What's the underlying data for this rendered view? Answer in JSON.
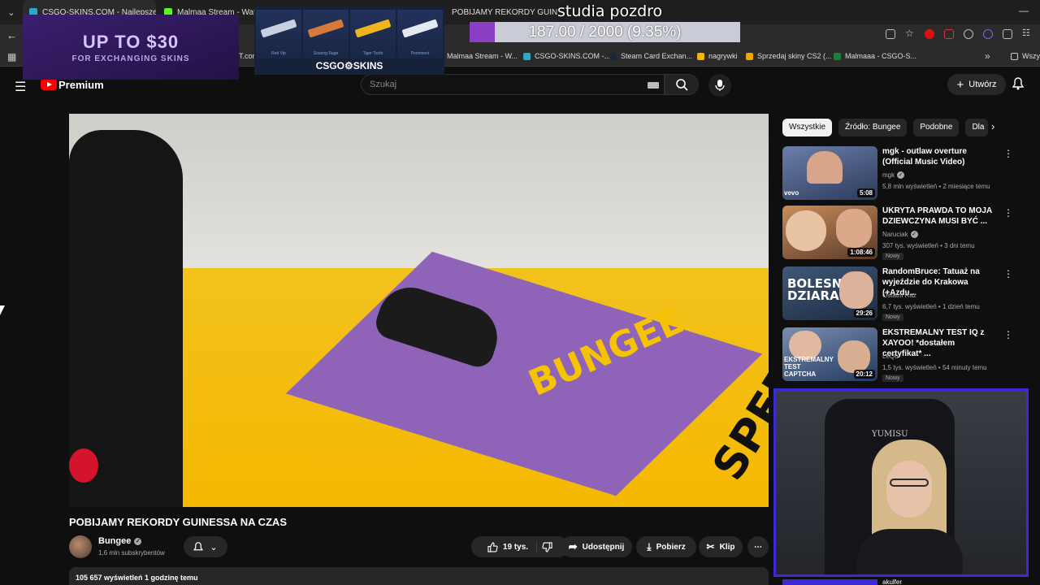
{
  "browser": {
    "tabs": [
      {
        "label": "CSGO-SKINS.COM - Najlepsze",
        "color": "#2aa9c8",
        "active": true
      },
      {
        "label": "Malmaa Stream - Watch Li",
        "color": "#53fc18",
        "active": false
      },
      {
        "label": "POBIJAMY REKORDY GUIN",
        "color": "#ff0000",
        "active": false
      }
    ],
    "bookmarks": [
      {
        "label": "Malmaa Stream - W...",
        "color": "#53fc18"
      },
      {
        "label": "CSGO-SKINS.COM -...",
        "color": "#2aa9c8"
      },
      {
        "label": "Steam Card Exchan...",
        "color": "#1b2838"
      },
      {
        "label": "nagrywki",
        "color": "#f4b400"
      },
      {
        "label": "Sprzedaj skiny CS2 (...",
        "color": "#f0a500"
      },
      {
        "label": "Malmaaa - CSGO-S...",
        "color": "#188038"
      }
    ],
    "bookmark_partial": "T.com",
    "bookmark_folder": "Wszy"
  },
  "overlay": {
    "promo_title": "UP TO $30",
    "promo_sub": "FOR EXCHANGING SKINS",
    "skins_brand": "CSGO⚙SKINS",
    "skins": [
      {
        "name": "Red Vip",
        "color": "#c6d0e0"
      },
      {
        "name": "Soaring Rage",
        "color": "#d47a3a"
      },
      {
        "name": "Tiger Tooth",
        "color": "#f0b51e"
      },
      {
        "name": "Prominent",
        "color": "#e4e8f0"
      }
    ],
    "goal_text": "187.00 / 2000 (9.35%)",
    "goal_fraction": 0.0935,
    "stream_note": "studia pozdro"
  },
  "youtube": {
    "brand": "Premium",
    "search_placeholder": "Szukaj",
    "create_label": "Utwórz"
  },
  "video": {
    "scene_text_mat": "BUNGEE",
    "scene_text_floor": "SPEED",
    "title": "POBIJAMY REKORDY GUINESSA NA CZAS",
    "channel": "Bungee",
    "subscribers": "1,6 mln subskrybentów",
    "likes": "19 tys.",
    "share_label": "Udostępnij",
    "download_label": "Pobierz",
    "clip_label": "Klip",
    "views_line": "105 657 wyświetleń  1 godzinę temu"
  },
  "sidebar": {
    "chips": [
      {
        "label": "Wszystkie",
        "active": true
      },
      {
        "label": "Źródło: Bungee",
        "active": false
      },
      {
        "label": "Podobne",
        "active": false
      },
      {
        "label": "Dla",
        "active": false
      }
    ],
    "recommendations": [
      {
        "title": "mgk - outlaw overture (Official Music Video)",
        "channel": "mgk",
        "verified": true,
        "meta": "5,8 mln wyświetleń • 2 miesiące temu",
        "duration": "5:08",
        "badge": "",
        "thumb": [
          "#6a7fa8",
          "#2c3a5c"
        ]
      },
      {
        "title": "UKRYTA PRAWDA TO MOJA DZIEWCZYNA MUSI BYĆ ...",
        "channel": "Naruciak",
        "verified": true,
        "meta": "307 tys. wyświetleń • 3 dni temu",
        "duration": "1:08:46",
        "badge": "Nowy",
        "thumb": [
          "#c98c5a",
          "#5a3a2a"
        ]
      },
      {
        "title": "RandomBruce: Tatuaż na wyjeździe do Krakowa (+Azdu...",
        "channel": "Ostatni Raz",
        "verified": false,
        "meta": "6,7 tys. wyświetleń • 1 dzień temu",
        "duration": "29:26",
        "badge": "Nowy",
        "thumb": [
          "#3f5878",
          "#1d2b40"
        ]
      },
      {
        "title": "EKSTREMALNY TEST IQ z XAYOO! *dostałem certyfikat* ...",
        "channel": "LeQu",
        "verified": false,
        "meta": "1,5 tys. wyświetleń • 54 minuty temu",
        "duration": "20:12",
        "badge": "Nowy",
        "thumb": [
          "#7a8fb0",
          "#23395e"
        ]
      }
    ],
    "thumb_overlays": [
      "",
      "",
      "BOLESNE DZIARANIE",
      "EKSTREMALNY TEST CAPTCHA"
    ],
    "next_channel_partial": "akulfer"
  },
  "webcam": {
    "chair_text": "YUMISU"
  }
}
